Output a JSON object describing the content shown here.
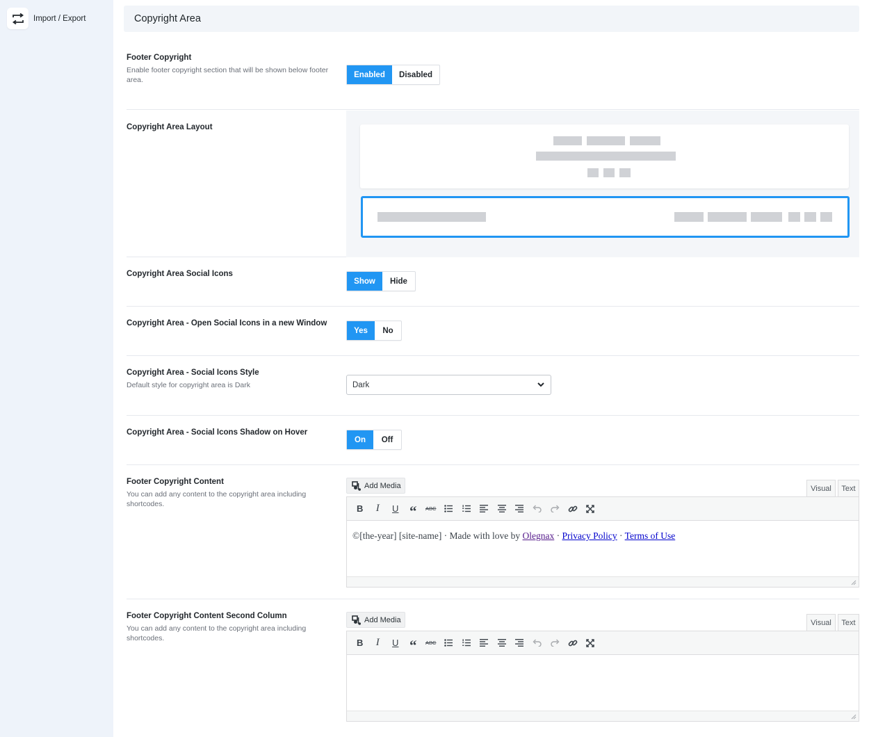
{
  "sidebar": {
    "items": [
      {
        "label": "Import / Export",
        "icon": "import-export-icon"
      }
    ]
  },
  "section": {
    "title": "Copyright Area"
  },
  "settings": {
    "footer_copyright": {
      "title": "Footer Copyright",
      "desc": "Enable footer copyright section that will be shown below footer area.",
      "options": [
        "Enabled",
        "Disabled"
      ],
      "selected": "Enabled"
    },
    "layout": {
      "title": "Copyright Area Layout",
      "options": [
        "centered",
        "split"
      ],
      "selected": "split"
    },
    "social_icons": {
      "title": "Copyright Area Social Icons",
      "options": [
        "Show",
        "Hide"
      ],
      "selected": "Show"
    },
    "new_window": {
      "title": "Copyright Area - Open Social Icons in a new Window",
      "options": [
        "Yes",
        "No"
      ],
      "selected": "Yes"
    },
    "icons_style": {
      "title": "Copyright Area - Social Icons Style",
      "desc": "Default style for copyright area is Dark",
      "value": "Dark"
    },
    "shadow_hover": {
      "title": "Copyright Area - Social Icons Shadow on Hover",
      "options": [
        "On",
        "Off"
      ],
      "selected": "On"
    },
    "content": {
      "title": "Footer Copyright Content",
      "desc": "You can add any content to the copyright area including shortcodes.",
      "add_media": "Add Media",
      "tab_visual": "Visual",
      "tab_text": "Text",
      "text_prefix": "©[the-year] [site-name] · Made with love by ",
      "link1": "Olegnax",
      "sep1": " · ",
      "link2": "Privacy Policy",
      "sep2": " · ",
      "link3": "Terms of Use"
    },
    "content2": {
      "title": "Footer Copyright Content Second Column",
      "desc": "You can add any content to the copyright area including shortcodes.",
      "add_media": "Add Media",
      "tab_visual": "Visual",
      "tab_text": "Text",
      "text": ""
    }
  },
  "toolbar_buttons": [
    "bold",
    "italic",
    "underline",
    "blockquote",
    "strikethrough",
    "bullet-list",
    "numbered-list",
    "align-left",
    "align-center",
    "align-right",
    "undo",
    "redo",
    "link",
    "fullscreen"
  ],
  "colors": {
    "accent": "#2196f3",
    "sidebar_bg": "#eef3fa",
    "header_bg": "#f2f5f9"
  }
}
